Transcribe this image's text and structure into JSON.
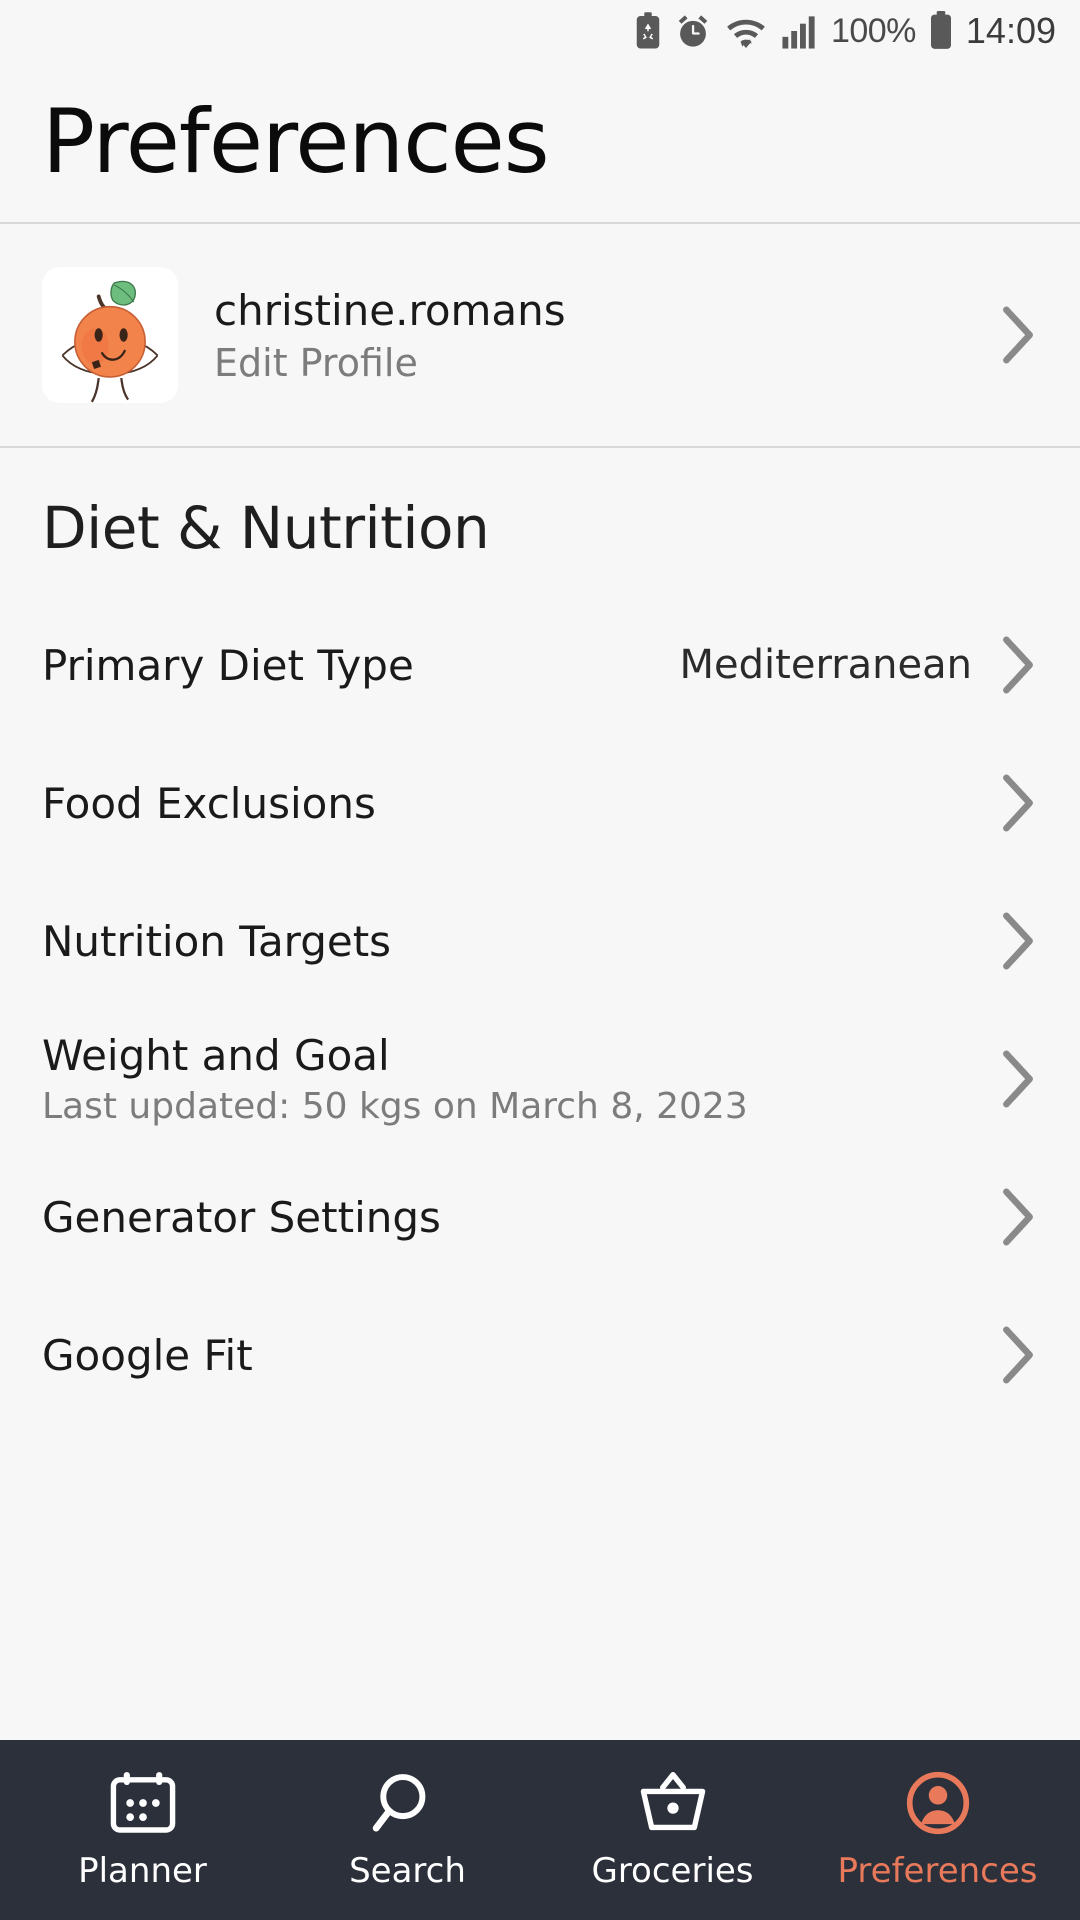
{
  "statusbar": {
    "icons": [
      "battery-saver-icon",
      "alarm-icon",
      "wifi-icon",
      "signal-bars-icon"
    ],
    "battery_percent": "100%",
    "time": "14:09"
  },
  "header": {
    "title": "Preferences"
  },
  "profile": {
    "avatar_name": "orange-character-avatar",
    "username": "christine.romans",
    "action": "Edit Profile",
    "chevron": "chevron-right-icon"
  },
  "section": {
    "title": "Diet & Nutrition",
    "rows": [
      {
        "label": "Primary Diet Type",
        "value": "Mediterranean",
        "sub": ""
      },
      {
        "label": "Food Exclusions",
        "value": "",
        "sub": ""
      },
      {
        "label": "Nutrition Targets",
        "value": "",
        "sub": ""
      },
      {
        "label": "Weight and Goal",
        "value": "",
        "sub": "Last updated:  50 kgs on March 8, 2023"
      },
      {
        "label": "Generator Settings",
        "value": "",
        "sub": ""
      },
      {
        "label": "Google Fit",
        "value": "",
        "sub": ""
      }
    ]
  },
  "bottomnav": {
    "active_color": "#E8795A",
    "inactive_color": "#FFFFFF",
    "background": "#2B303B",
    "items": [
      {
        "label": "Planner",
        "icon": "calendar-icon",
        "active": false
      },
      {
        "label": "Search",
        "icon": "search-icon",
        "active": false
      },
      {
        "label": "Groceries",
        "icon": "basket-icon",
        "active": false
      },
      {
        "label": "Preferences",
        "icon": "account-circle-icon",
        "active": true
      }
    ]
  }
}
